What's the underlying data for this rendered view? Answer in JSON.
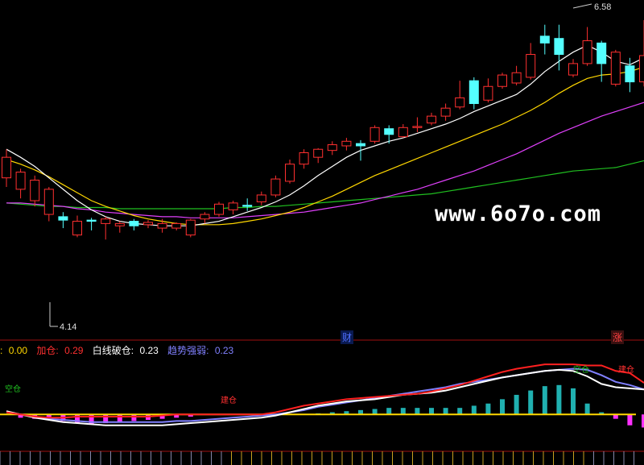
{
  "watermark": "www.6o7o.com",
  "price_high_label": "6.58",
  "price_low_label": "4.14",
  "event_markers": [
    "财",
    "涨"
  ],
  "indicator_legend": {
    "item0": {
      "label": ":",
      "value": "0.00",
      "color": "#ffd700"
    },
    "item1": {
      "label": "加仓:",
      "value": "0.29",
      "color": "#ff3030"
    },
    "item2": {
      "label": "白线破仓:",
      "value": "0.23",
      "color": "#ffffff"
    },
    "item3": {
      "label": "趋势强弱:",
      "value": "0.23",
      "color": "#8080ff"
    }
  },
  "indicator_signal_labels": [
    "空仓",
    "建仓",
    "空仓",
    "建仓"
  ],
  "colors": {
    "up": "#ff3030",
    "down": "#54ffff",
    "ma5": "#ffffff",
    "ma10": "#ffd700",
    "ma20": "#e040fb",
    "ma60": "#20c020",
    "panel_border": "#a01010"
  },
  "chart_data": [
    {
      "type": "candlestick",
      "ylim": [
        3.9,
        6.7
      ],
      "candles": [
        [
          5.2,
          5.38,
          5.12,
          5.45
        ],
        [
          5.1,
          5.25,
          5.02,
          5.28
        ],
        [
          5.0,
          5.18,
          4.95,
          5.22
        ],
        [
          4.88,
          5.1,
          4.82,
          5.12
        ],
        [
          4.86,
          4.83,
          4.76,
          4.9
        ],
        [
          4.7,
          4.82,
          4.68,
          4.87
        ],
        [
          4.83,
          4.82,
          4.74,
          4.85
        ],
        [
          4.8,
          4.84,
          4.66,
          4.86
        ],
        [
          4.78,
          4.8,
          4.72,
          4.82
        ],
        [
          4.82,
          4.78,
          4.74,
          4.84
        ],
        [
          4.79,
          4.81,
          4.76,
          4.83
        ],
        [
          4.76,
          4.8,
          4.72,
          4.84
        ],
        [
          4.76,
          4.8,
          4.74,
          4.81
        ],
        [
          4.7,
          4.83,
          4.68,
          4.84
        ],
        [
          4.84,
          4.88,
          4.8,
          4.9
        ],
        [
          4.88,
          4.97,
          4.86,
          4.99
        ],
        [
          4.92,
          4.98,
          4.88,
          5.0
        ],
        [
          4.96,
          4.95,
          4.91,
          5.02
        ],
        [
          4.99,
          5.05,
          4.96,
          5.08
        ],
        [
          5.05,
          5.19,
          5.03,
          5.22
        ],
        [
          5.17,
          5.32,
          5.15,
          5.36
        ],
        [
          5.32,
          5.42,
          5.28,
          5.45
        ],
        [
          5.38,
          5.45,
          5.33,
          5.46
        ],
        [
          5.44,
          5.49,
          5.4,
          5.52
        ],
        [
          5.48,
          5.52,
          5.44,
          5.55
        ],
        [
          5.5,
          5.48,
          5.35,
          5.53
        ],
        [
          5.52,
          5.64,
          5.5,
          5.66
        ],
        [
          5.63,
          5.58,
          5.5,
          5.66
        ],
        [
          5.56,
          5.64,
          5.55,
          5.67
        ],
        [
          5.64,
          5.65,
          5.6,
          5.73
        ],
        [
          5.68,
          5.74,
          5.66,
          5.77
        ],
        [
          5.74,
          5.81,
          5.7,
          5.85
        ],
        [
          5.82,
          5.9,
          5.8,
          6.05
        ],
        [
          6.05,
          5.85,
          5.8,
          6.08
        ],
        [
          5.88,
          6.0,
          5.86,
          6.07
        ],
        [
          6.0,
          6.1,
          5.98,
          6.12
        ],
        [
          6.03,
          6.12,
          6.01,
          6.18
        ],
        [
          6.08,
          6.28,
          6.06,
          6.38
        ],
        [
          6.44,
          6.38,
          6.28,
          6.54
        ],
        [
          6.42,
          6.28,
          6.14,
          6.54
        ],
        [
          6.1,
          6.2,
          6.08,
          6.24
        ],
        [
          6.2,
          6.4,
          6.18,
          6.52
        ],
        [
          6.38,
          6.2,
          6.04,
          6.4
        ],
        [
          6.02,
          6.3,
          6.0,
          6.32
        ],
        [
          6.18,
          6.04,
          5.95,
          6.25
        ],
        [
          6.04,
          6.27,
          6.0,
          6.58
        ]
      ],
      "ma5": [
        5.45,
        5.38,
        5.3,
        5.2,
        5.1,
        5.0,
        4.92,
        4.86,
        4.82,
        4.8,
        4.79,
        4.78,
        4.78,
        4.78,
        4.8,
        4.82,
        4.86,
        4.9,
        4.94,
        4.99,
        5.05,
        5.13,
        5.22,
        5.3,
        5.38,
        5.44,
        5.48,
        5.52,
        5.55,
        5.59,
        5.63,
        5.67,
        5.72,
        5.78,
        5.83,
        5.88,
        5.93,
        6.02,
        6.13,
        6.22,
        6.3,
        6.36,
        6.3,
        6.22,
        6.19,
        6.25
      ],
      "ma10": [
        5.36,
        5.32,
        5.27,
        5.21,
        5.14,
        5.07,
        5.0,
        4.95,
        4.91,
        4.87,
        4.84,
        4.82,
        4.8,
        4.79,
        4.79,
        4.79,
        4.8,
        4.82,
        4.84,
        4.87,
        4.9,
        4.94,
        4.99,
        5.04,
        5.1,
        5.16,
        5.22,
        5.27,
        5.32,
        5.37,
        5.42,
        5.47,
        5.52,
        5.57,
        5.62,
        5.67,
        5.73,
        5.79,
        5.86,
        5.94,
        6.01,
        6.07,
        6.1,
        6.11,
        6.13,
        6.17
      ],
      "ma20": [
        4.98,
        4.98,
        4.97,
        4.96,
        4.95,
        4.93,
        4.92,
        4.9,
        4.89,
        4.88,
        4.87,
        4.86,
        4.86,
        4.85,
        4.85,
        4.85,
        4.85,
        4.86,
        4.87,
        4.88,
        4.89,
        4.9,
        4.92,
        4.94,
        4.96,
        4.98,
        5.01,
        5.04,
        5.07,
        5.1,
        5.14,
        5.18,
        5.22,
        5.26,
        5.31,
        5.36,
        5.41,
        5.47,
        5.53,
        5.59,
        5.64,
        5.69,
        5.74,
        5.78,
        5.82,
        5.86
      ],
      "ma60": [
        4.98,
        4.97,
        4.96,
        4.95,
        4.95,
        4.94,
        4.94,
        4.94,
        4.93,
        4.93,
        4.93,
        4.93,
        4.93,
        4.93,
        4.93,
        4.93,
        4.94,
        4.94,
        4.95,
        4.95,
        4.96,
        4.97,
        4.98,
        4.99,
        5.0,
        5.01,
        5.02,
        5.03,
        5.04,
        5.05,
        5.06,
        5.08,
        5.1,
        5.12,
        5.14,
        5.16,
        5.18,
        5.2,
        5.22,
        5.24,
        5.26,
        5.27,
        5.28,
        5.29,
        5.32,
        5.35
      ]
    },
    {
      "type": "bar",
      "ylim": [
        -0.25,
        0.55
      ],
      "values": [
        0,
        -0.03,
        -0.04,
        -0.05,
        -0.06,
        -0.08,
        -0.09,
        -0.08,
        -0.07,
        -0.06,
        -0.05,
        -0.04,
        -0.03,
        -0.02,
        0,
        0,
        0,
        0,
        0,
        0,
        0,
        0,
        0.01,
        0.02,
        0.03,
        0.04,
        0.05,
        0.06,
        0.06,
        0.06,
        0.06,
        0.06,
        0.06,
        0.08,
        0.1,
        0.14,
        0.18,
        0.22,
        0.26,
        0.27,
        0.24,
        0.1,
        0.02,
        -0.04,
        -0.1,
        -0.12
      ],
      "series_red": [
        0.02,
        0.0,
        -0.02,
        -0.03,
        -0.03,
        -0.02,
        -0.02,
        -0.02,
        -0.02,
        -0.02,
        -0.02,
        -0.01,
        0,
        0,
        0,
        0,
        0,
        0,
        0.0,
        0.02,
        0.05,
        0.08,
        0.1,
        0.12,
        0.14,
        0.15,
        0.16,
        0.17,
        0.18,
        0.19,
        0.21,
        0.24,
        0.27,
        0.31,
        0.35,
        0.39,
        0.42,
        0.44,
        0.46,
        0.46,
        0.46,
        0.45,
        0.45,
        0.4,
        0.38,
        0.29
      ],
      "series_white": [
        0.03,
        0.0,
        -0.03,
        -0.05,
        -0.07,
        -0.08,
        -0.09,
        -0.1,
        -0.1,
        -0.1,
        -0.1,
        -0.1,
        -0.09,
        -0.08,
        -0.07,
        -0.06,
        -0.05,
        -0.04,
        -0.03,
        -0.01,
        0.02,
        0.05,
        0.08,
        0.1,
        0.12,
        0.13,
        0.14,
        0.16,
        0.18,
        0.19,
        0.2,
        0.22,
        0.25,
        0.28,
        0.31,
        0.34,
        0.36,
        0.38,
        0.4,
        0.41,
        0.4,
        0.35,
        0.28,
        0.25,
        0.24,
        0.23
      ],
      "series_blue": [
        0.02,
        0.0,
        -0.02,
        -0.04,
        -0.05,
        -0.06,
        -0.07,
        -0.07,
        -0.07,
        -0.07,
        -0.07,
        -0.07,
        -0.06,
        -0.06,
        -0.05,
        -0.04,
        -0.03,
        -0.02,
        -0.01,
        0.0,
        0.02,
        0.04,
        0.07,
        0.09,
        0.11,
        0.13,
        0.15,
        0.17,
        0.19,
        0.21,
        0.23,
        0.25,
        0.28,
        0.3,
        0.32,
        0.34,
        0.36,
        0.38,
        0.4,
        0.41,
        0.42,
        0.41,
        0.36,
        0.3,
        0.27,
        0.23
      ],
      "series_yellow": 0.0
    }
  ]
}
